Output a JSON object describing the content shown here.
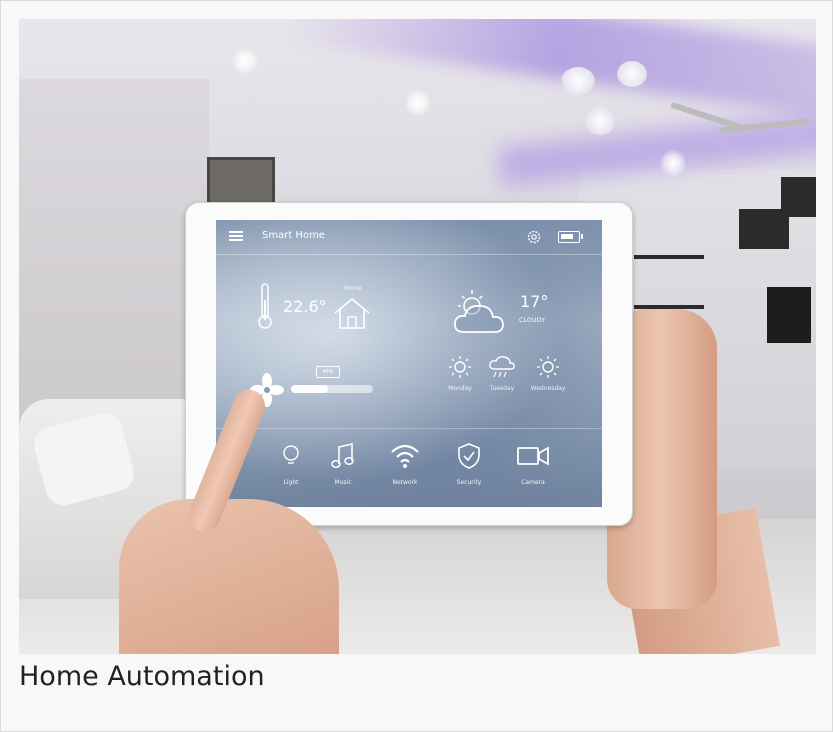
{
  "caption": "Home Automation",
  "tablet": {
    "app_title": "Smart Home",
    "temperature": "22.6°",
    "home_label": "Home",
    "weather_temp": "17°",
    "weather_condition": "CLOUDY",
    "fan_slider_label": "45%",
    "fan_level": 0.45,
    "forecast": [
      {
        "day": "Monday",
        "icon": "sun-icon"
      },
      {
        "day": "Tuesday",
        "icon": "rain-cloud-icon"
      },
      {
        "day": "Wednesday",
        "icon": "sun-icon"
      }
    ],
    "dock": [
      {
        "label": "Light",
        "icon": "bulb-icon"
      },
      {
        "label": "Music",
        "icon": "music-note-icon"
      },
      {
        "label": "Network",
        "icon": "wifi-icon"
      },
      {
        "label": "Security",
        "icon": "shield-check-icon"
      },
      {
        "label": "Camera",
        "icon": "video-camera-icon"
      }
    ]
  }
}
